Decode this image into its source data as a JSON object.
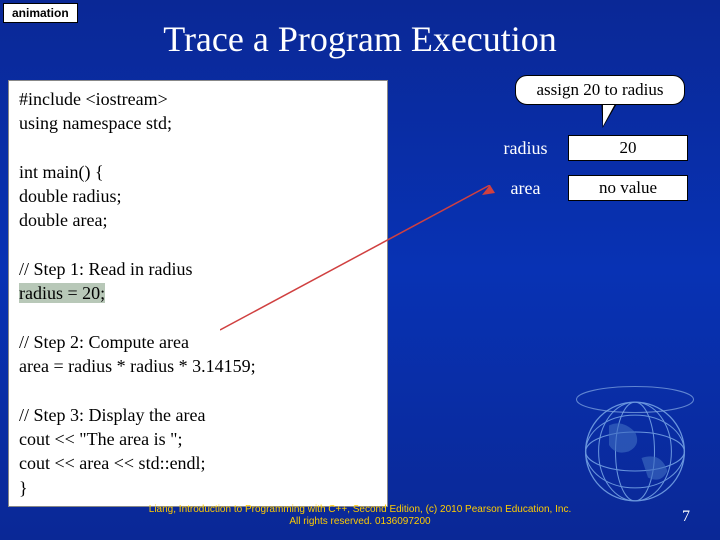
{
  "tag": "animation",
  "title": "Trace a Program Execution",
  "callout": "assign 20 to radius",
  "vars": [
    {
      "name": "radius",
      "value": "20"
    },
    {
      "name": "area",
      "value": "no value"
    }
  ],
  "code": {
    "line1": "#include <iostream>",
    "line2": "using namespace std;",
    "line3": "",
    "line4": "int main() {",
    "line5": "  double radius;",
    "line6": "  double area;",
    "line7": "",
    "line8": "  // Step 1: Read in radius",
    "line9_hl": "  radius = 20;",
    "line10": "",
    "line11": "  // Step 2: Compute area",
    "line12": "  area = radius * radius * 3.14159;",
    "line13": "",
    "line14": "  // Step 3: Display the area",
    "line15": "  cout << \"The area is \";",
    "line16": "  cout << area << std::endl;",
    "line17": "}"
  },
  "footer1": "Liang, Introduction to Programming with C++, Second Edition, (c) 2010 Pearson Education, Inc.",
  "footer2": "All rights reserved. 0136097200",
  "page": "7"
}
